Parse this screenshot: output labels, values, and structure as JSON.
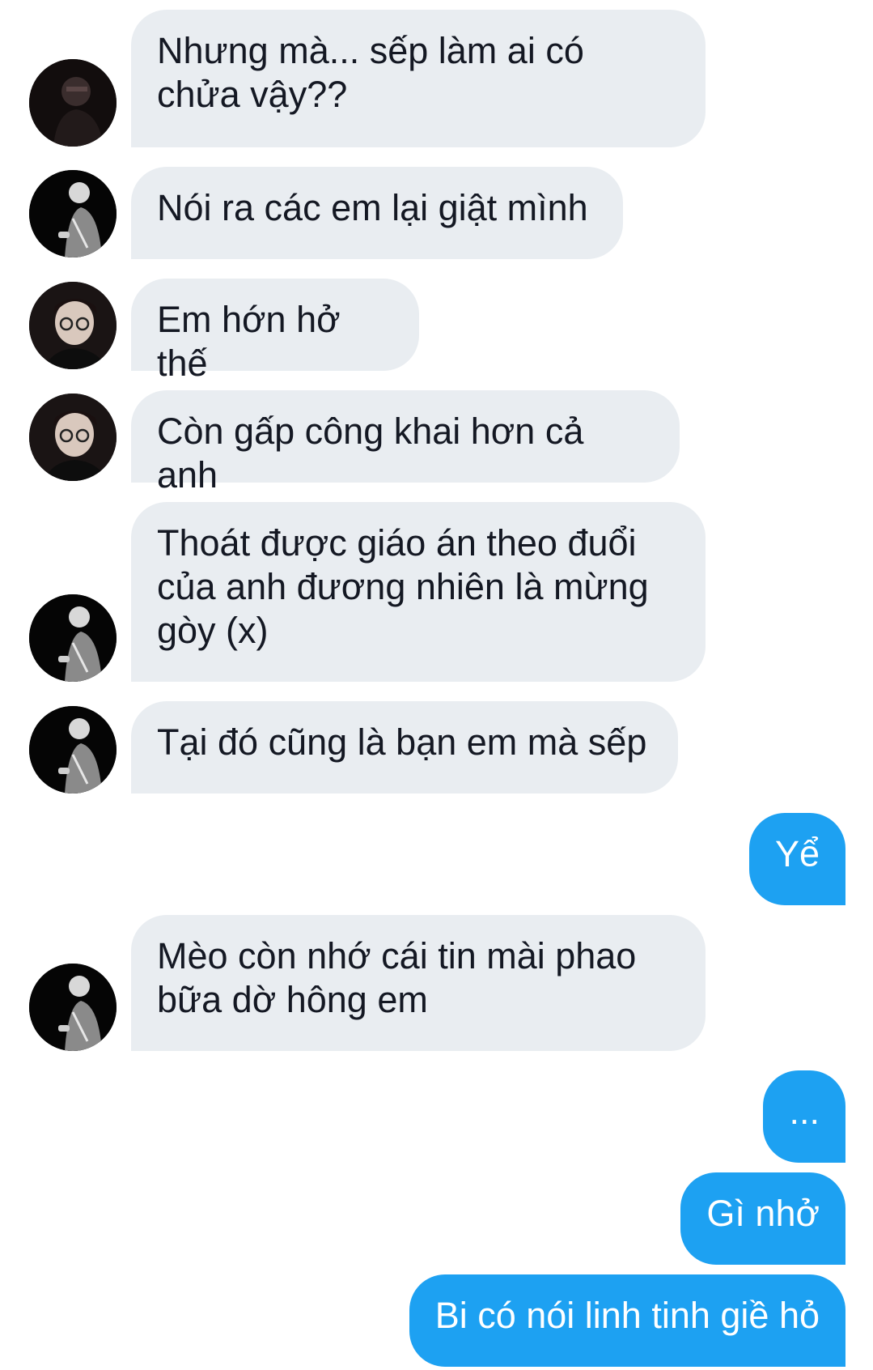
{
  "messages": [
    {
      "text": "Nhưng mà... sếp làm ai có\nchửa vậy??",
      "avatar": "avatar-dark-portrait"
    },
    {
      "text": "Nói ra các em lại giật mình",
      "avatar": "avatar-bw-side-profile"
    },
    {
      "text": "Em hớn hở thế",
      "avatar": "avatar-glasses-portrait"
    },
    {
      "text": "Còn gấp công khai hơn cả anh",
      "avatar": "avatar-glasses-portrait"
    },
    {
      "text": "Thoát được giáo án theo đuổi\ncủa anh đương nhiên là mừng\ngòy (x)",
      "avatar": "avatar-bw-side-profile"
    },
    {
      "text": "Tại đó cũng là bạn em mà sếp",
      "avatar": "avatar-bw-side-profile"
    },
    {
      "text": "Yể"
    },
    {
      "text": "Mèo còn nhớ cái tin mài phao\nbữa dờ hông em",
      "avatar": "avatar-bw-side-profile"
    },
    {
      "text": "..."
    },
    {
      "text": "Gì nhở"
    },
    {
      "text": "Bi có nói linh tinh giề hỏ"
    }
  ],
  "colors": {
    "incoming_bubble": "#e9edf1",
    "outgoing_bubble": "#1da1f2",
    "incoming_text": "#141823",
    "outgoing_text": "#ffffff"
  }
}
